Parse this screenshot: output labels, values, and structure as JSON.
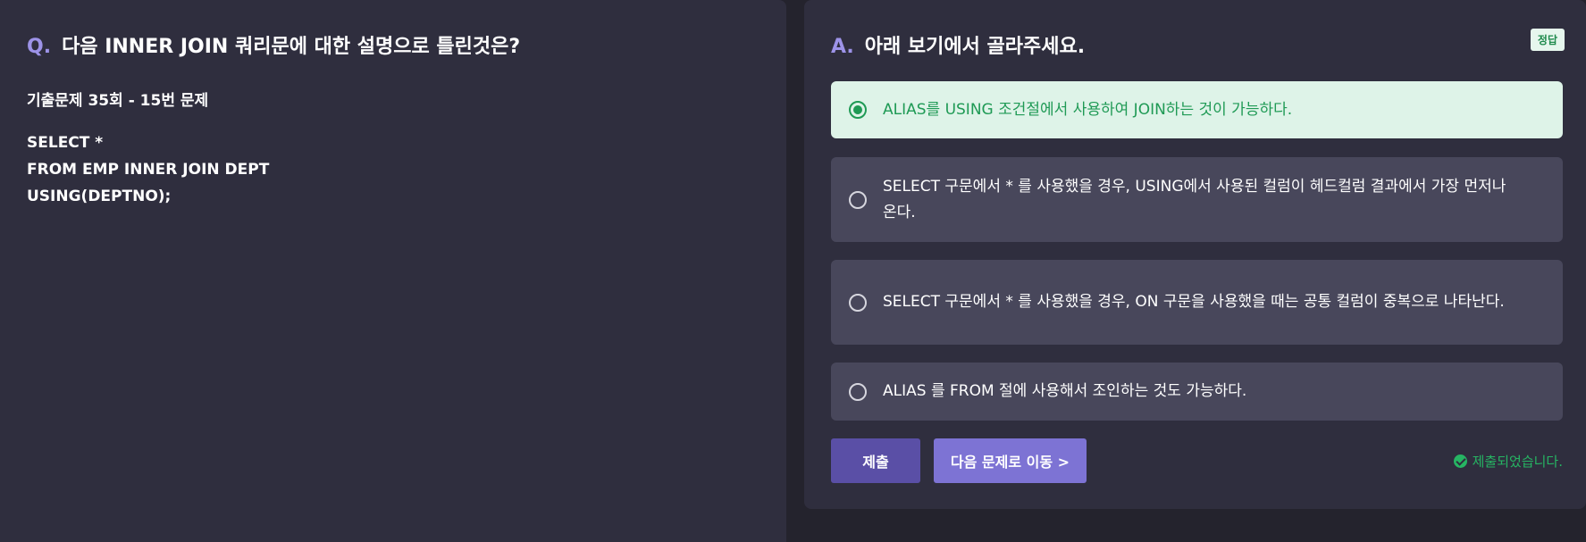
{
  "question": {
    "marker": "Q.",
    "title": "다음 INNER JOIN 쿼리문에 대한 설명으로 틀린것은?",
    "subtitle": "기출문제 35회 - 15번 문제",
    "code_lines": [
      "SELECT *",
      "FROM EMP INNER JOIN DEPT",
      "USING(DEPTNO);"
    ]
  },
  "answer": {
    "marker": "A.",
    "title": "아래 보기에서 골라주세요.",
    "badge": "정답",
    "options": [
      {
        "label": "ALIAS를 USING 조건절에서 사용하여 JOIN하는 것이 가능하다.",
        "selected": true
      },
      {
        "label": "SELECT 구문에서 * 를 사용했을 경우, USING에서 사용된 컬럼이 헤드컬럼 결과에서 가장 먼저나온다.",
        "selected": false
      },
      {
        "label": "SELECT 구문에서 * 를 사용했을 경우, ON 구문을 사용했을 때는 공통 컬럼이 중복으로 나타난다.",
        "selected": false
      },
      {
        "label": "ALIAS 를 FROM 절에 사용해서 조인하는 것도 가능하다.",
        "selected": false
      }
    ],
    "submit_label": "제출",
    "next_label": "다음 문제로 이동 >",
    "status_text": "제출되었습니다."
  },
  "colors": {
    "accent": "#9d93e8",
    "correct": "#1f9a55",
    "panel": "#2f2e3e",
    "option_bg": "#48475b"
  }
}
